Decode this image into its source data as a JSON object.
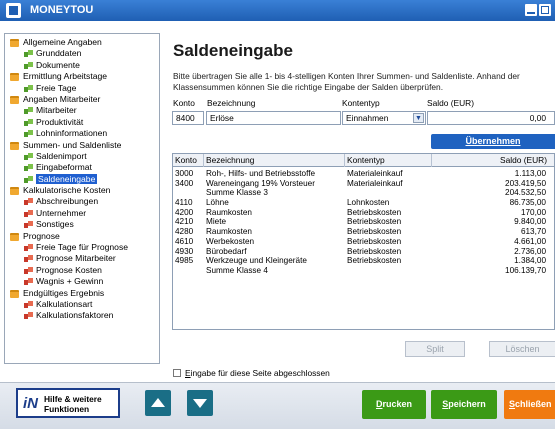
{
  "window": {
    "title": "MONEYTOU"
  },
  "tree": [
    {
      "label": "Allgemeine Angaben",
      "level": 0,
      "icon": "folder-icon"
    },
    {
      "label": "Grunddaten",
      "level": 1,
      "icon": "step-icon-green"
    },
    {
      "label": "Dokumente",
      "level": 1,
      "icon": "step-icon-green"
    },
    {
      "label": "Ermittlung Arbeitstage",
      "level": 0,
      "icon": "folder-icon"
    },
    {
      "label": "Freie Tage",
      "level": 1,
      "icon": "step-icon-green"
    },
    {
      "label": "Angaben Mitarbeiter",
      "level": 0,
      "icon": "folder-icon"
    },
    {
      "label": "Mitarbeiter",
      "level": 1,
      "icon": "step-icon-green"
    },
    {
      "label": "Produktivität",
      "level": 1,
      "icon": "step-icon-green"
    },
    {
      "label": "Lohninformationen",
      "level": 1,
      "icon": "step-icon-green"
    },
    {
      "label": "Summen- und Saldenliste",
      "level": 0,
      "icon": "folder-icon"
    },
    {
      "label": "Saldenimport",
      "level": 1,
      "icon": "step-icon-green"
    },
    {
      "label": "Eingabeformat",
      "level": 1,
      "icon": "step-icon-green"
    },
    {
      "label": "Saldeneingabe",
      "level": 1,
      "icon": "step-icon-green",
      "selected": true
    },
    {
      "label": "Kalkulatorische Kosten",
      "level": 0,
      "icon": "folder-icon"
    },
    {
      "label": "Abschreibungen",
      "level": 1,
      "icon": "step-icon-red"
    },
    {
      "label": "Unternehmer",
      "level": 1,
      "icon": "step-icon-red"
    },
    {
      "label": "Sonstiges",
      "level": 1,
      "icon": "step-icon-red"
    },
    {
      "label": "Prognose",
      "level": 0,
      "icon": "folder-icon"
    },
    {
      "label": "Freie Tage für Prognose",
      "level": 1,
      "icon": "step-icon-red"
    },
    {
      "label": "Prognose Mitarbeiter",
      "level": 1,
      "icon": "step-icon-red"
    },
    {
      "label": "Prognose Kosten",
      "level": 1,
      "icon": "step-icon-red"
    },
    {
      "label": "Wagnis + Gewinn",
      "level": 1,
      "icon": "step-icon-red"
    },
    {
      "label": "Endgültiges Ergebnis",
      "level": 0,
      "icon": "folder-icon"
    },
    {
      "label": "Kalkulationsart",
      "level": 1,
      "icon": "step-icon-red"
    },
    {
      "label": "Kalkulationsfaktoren",
      "level": 1,
      "icon": "step-icon-red"
    }
  ],
  "main": {
    "title": "Saldeneingabe",
    "description": "Bitte übertragen Sie alle 1- bis 4-stelligen Konten Ihrer Summen- und Saldenliste. Anhand der Klassensummen können Sie die richtige Eingabe der Salden überprüfen.",
    "form": {
      "konto_label": "Konto",
      "bezeichnung_label": "Bezeichnung",
      "kontentyp_label": "Kontentyp",
      "saldo_label": "Saldo (EUR)",
      "konto_value": "8400",
      "bezeichnung_value": "Erlöse",
      "kontentyp_value": "Einnahmen",
      "saldo_value": "0,00",
      "uebernehmen_label": "Übernehmen"
    },
    "table": {
      "columns": [
        "Konto",
        "Bezeichnung",
        "Kontentyp",
        "Saldo (EUR)"
      ],
      "rows": [
        {
          "konto": "3000",
          "bezeichnung": "Roh-, Hilfs- und Betriebsstoffe",
          "kontentyp": "Materialeinkauf",
          "saldo": "1.113,00"
        },
        {
          "konto": "3400",
          "bezeichnung": "Wareneingang 19% Vorsteuer",
          "kontentyp": "Materialeinkauf",
          "saldo": "203.419,50"
        },
        {
          "konto": "",
          "bezeichnung": "Summe Klasse 3",
          "kontentyp": "",
          "saldo": "204.532,50"
        },
        {
          "konto": "4110",
          "bezeichnung": "Löhne",
          "kontentyp": "Lohnkosten",
          "saldo": "86.735,00"
        },
        {
          "konto": "4200",
          "bezeichnung": "Raumkosten",
          "kontentyp": "Betriebskosten",
          "saldo": "170,00"
        },
        {
          "konto": "4210",
          "bezeichnung": "Miete",
          "kontentyp": "Betriebskosten",
          "saldo": "9.840,00"
        },
        {
          "konto": "4280",
          "bezeichnung": "Raumkosten",
          "kontentyp": "Betriebskosten",
          "saldo": "613,70"
        },
        {
          "konto": "4610",
          "bezeichnung": "Werbekosten",
          "kontentyp": "Betriebskosten",
          "saldo": "4.661,00"
        },
        {
          "konto": "4930",
          "bezeichnung": "Bürobedarf",
          "kontentyp": "Betriebskosten",
          "saldo": "2.736,00"
        },
        {
          "konto": "4985",
          "bezeichnung": "Werkzeuge und Kleingeräte",
          "kontentyp": "Betriebskosten",
          "saldo": "1.384,00"
        },
        {
          "konto": "",
          "bezeichnung": "Summe Klasse 4",
          "kontentyp": "",
          "saldo": "106.139,70"
        }
      ]
    },
    "split_label": "Split",
    "loeschen_label": "Löschen",
    "checkbox_label": "Eingabe für diese Seite abgeschlossen"
  },
  "footer": {
    "help_line1": "Hilfe & weitere",
    "help_line2": "Funktionen",
    "drucken_label": "Drucken",
    "speichern_label": "Speichern",
    "schliessen_label": "Schließen"
  }
}
